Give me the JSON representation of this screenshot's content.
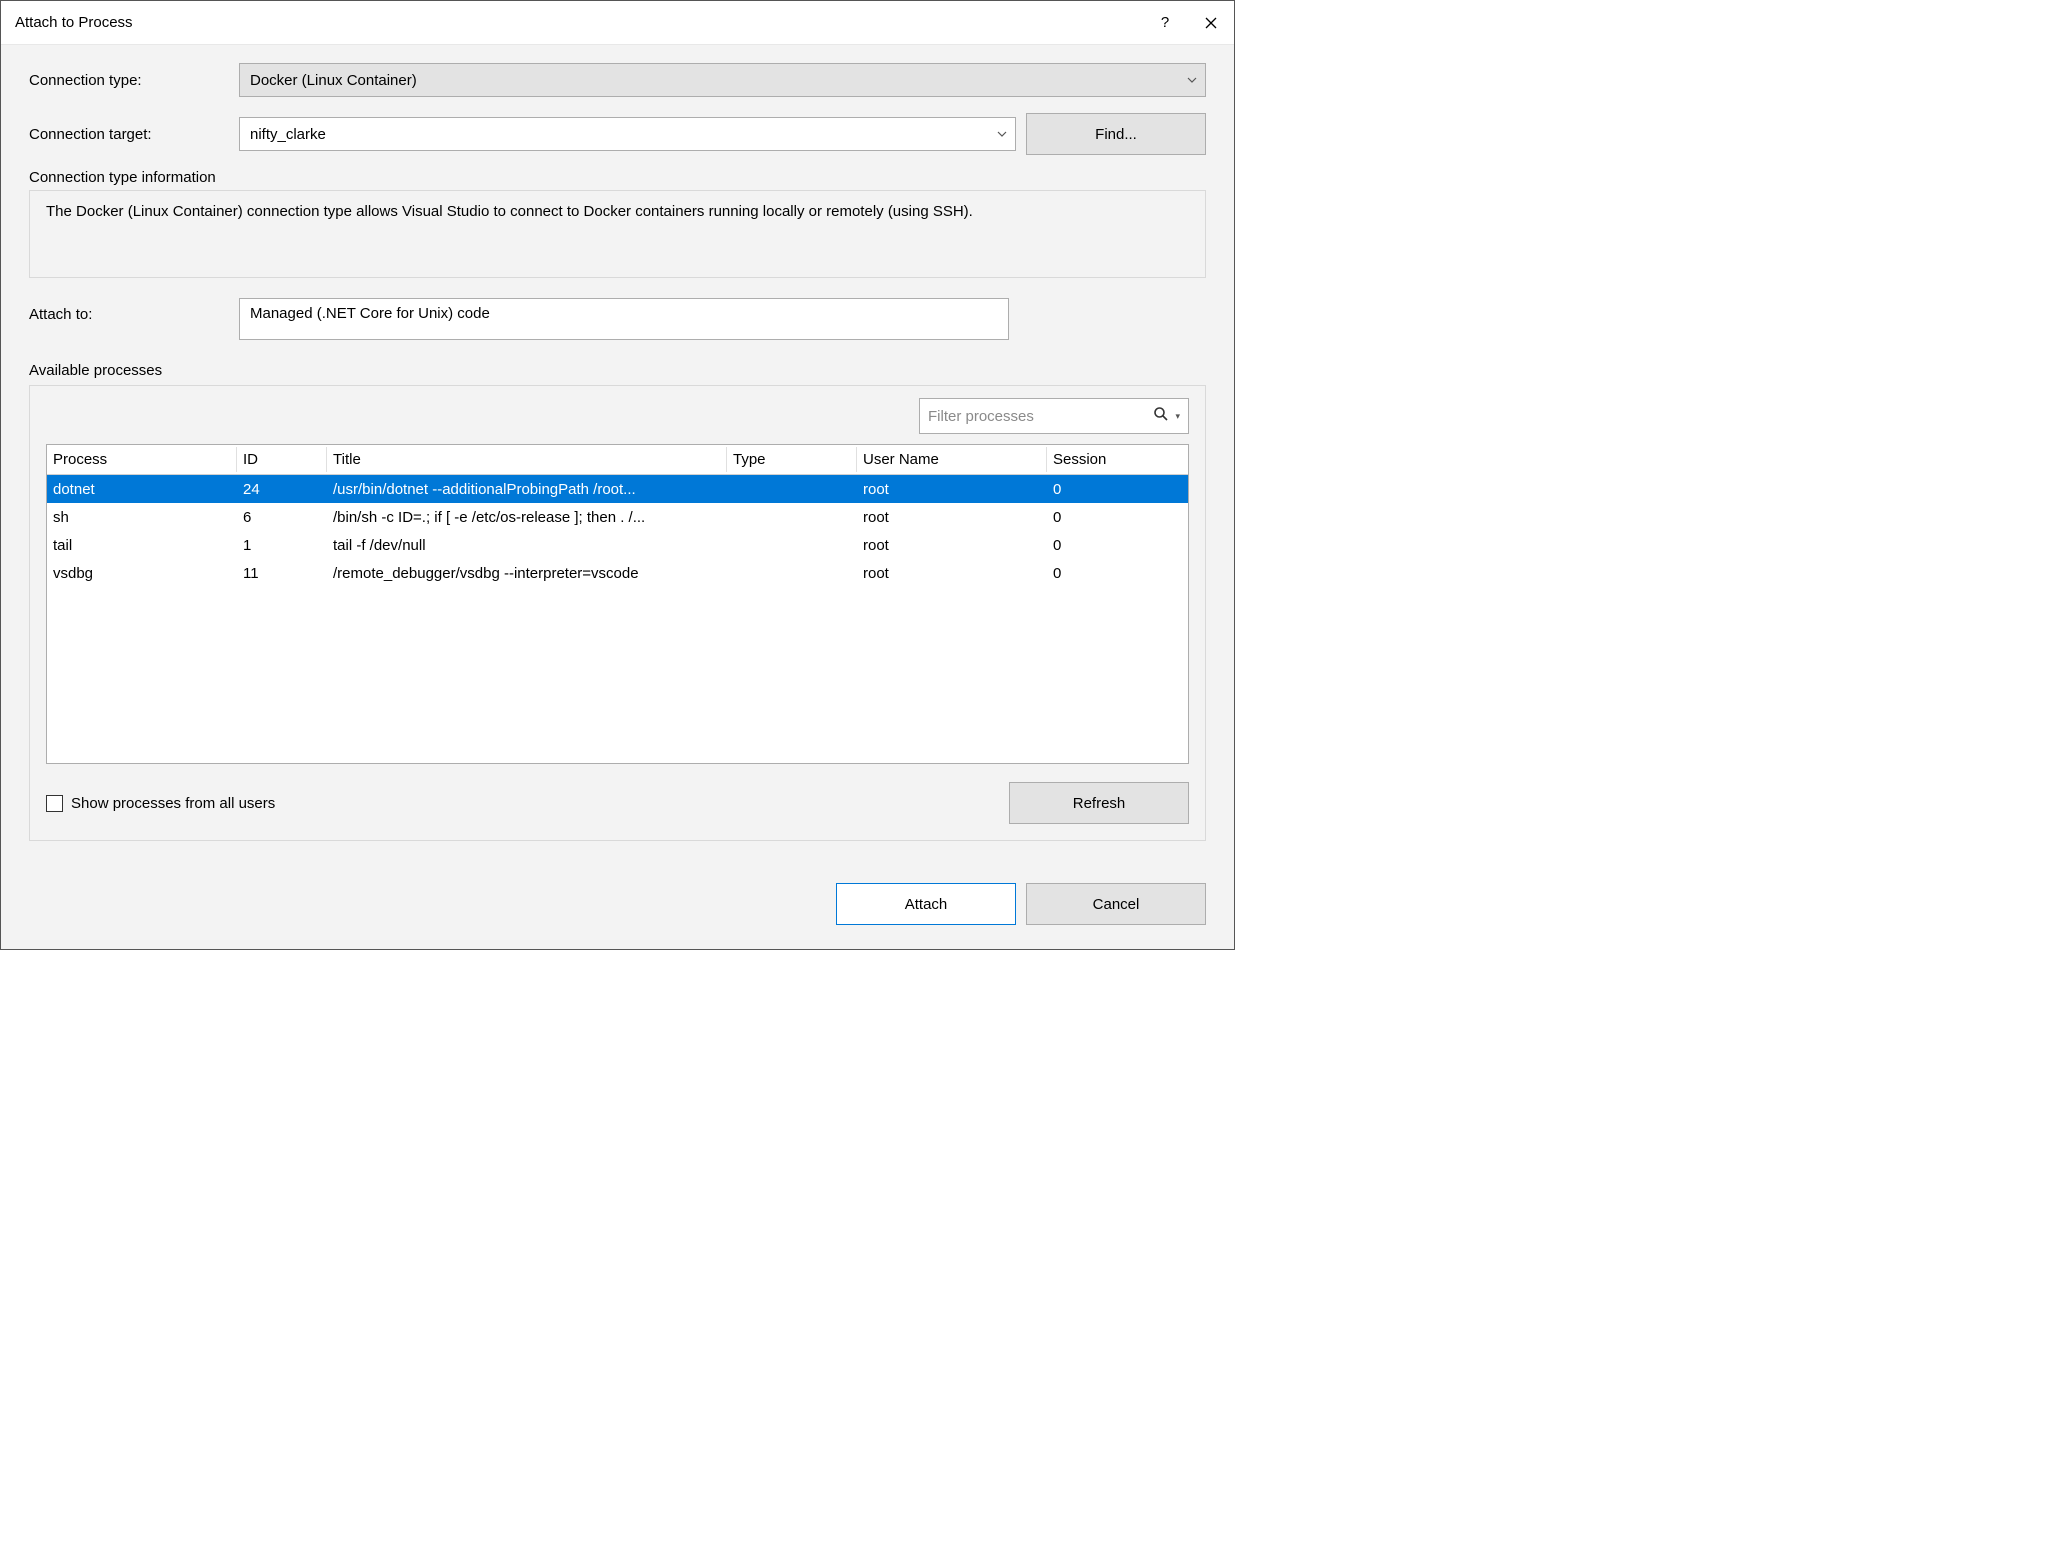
{
  "titlebar": {
    "title": "Attach to Process"
  },
  "labels": {
    "connection_type": "Connection type:",
    "connection_target": "Connection target:",
    "find": "Find...",
    "info_title": "Connection type information",
    "info_body": "The Docker (Linux Container) connection type allows Visual Studio to connect to Docker containers running locally or remotely (using SSH).",
    "attach_to": "Attach to:",
    "available": "Available processes",
    "filter_placeholder": "Filter processes",
    "show_all": "Show processes from all users",
    "refresh": "Refresh",
    "attach": "Attach",
    "cancel": "Cancel"
  },
  "values": {
    "connection_type": "Docker (Linux Container)",
    "connection_target": "nifty_clarke",
    "attach_to": "Managed (.NET Core for Unix) code"
  },
  "columns": {
    "process": "Process",
    "id": "ID",
    "title": "Title",
    "type": "Type",
    "user": "User Name",
    "session": "Session"
  },
  "processes": [
    {
      "process": "dotnet",
      "id": "24",
      "title": "/usr/bin/dotnet --additionalProbingPath /root...",
      "type": "",
      "user": "root",
      "session": "0",
      "selected": true
    },
    {
      "process": "sh",
      "id": "6",
      "title": "/bin/sh -c ID=.; if [ -e /etc/os-release ]; then . /...",
      "type": "",
      "user": "root",
      "session": "0"
    },
    {
      "process": "tail",
      "id": "1",
      "title": "tail -f /dev/null",
      "type": "",
      "user": "root",
      "session": "0"
    },
    {
      "process": "vsdbg",
      "id": "11",
      "title": "/remote_debugger/vsdbg --interpreter=vscode",
      "type": "",
      "user": "root",
      "session": "0"
    }
  ]
}
